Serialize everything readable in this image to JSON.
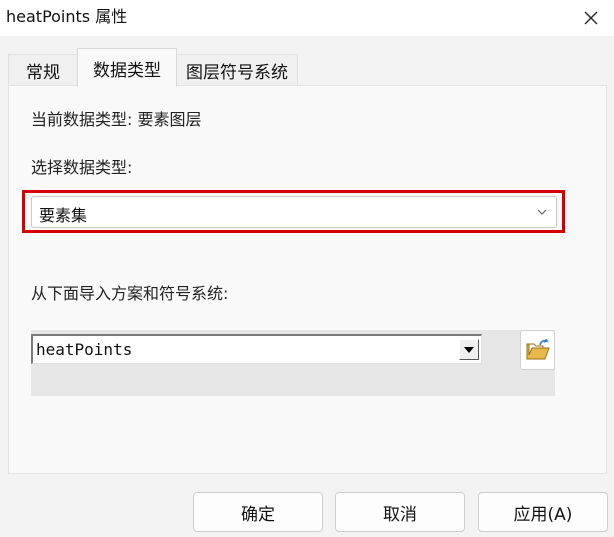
{
  "window": {
    "title": "heatPoints 属性"
  },
  "tabs": [
    {
      "label": "常规"
    },
    {
      "label": "数据类型"
    },
    {
      "label": "图层符号系统"
    }
  ],
  "panel": {
    "current_type_label": "当前数据类型: 要素图层",
    "select_type_label": "选择数据类型:",
    "data_type_select": {
      "value": "要素集"
    },
    "import_label": "从下面导入方案和符号系统:",
    "scheme_select": {
      "value": "heatPoints"
    }
  },
  "buttons": {
    "ok": "确定",
    "cancel": "取消",
    "apply": "应用(A)"
  },
  "icons": {
    "close": "close-icon",
    "chevron": "chevron-down-icon",
    "dropdown_arrow": "dropdown-arrow-icon",
    "folder": "folder-open-icon"
  },
  "colors": {
    "highlight": "#d60000",
    "folder": "#e8b84a",
    "folder_arrow": "#2f7fd6"
  }
}
